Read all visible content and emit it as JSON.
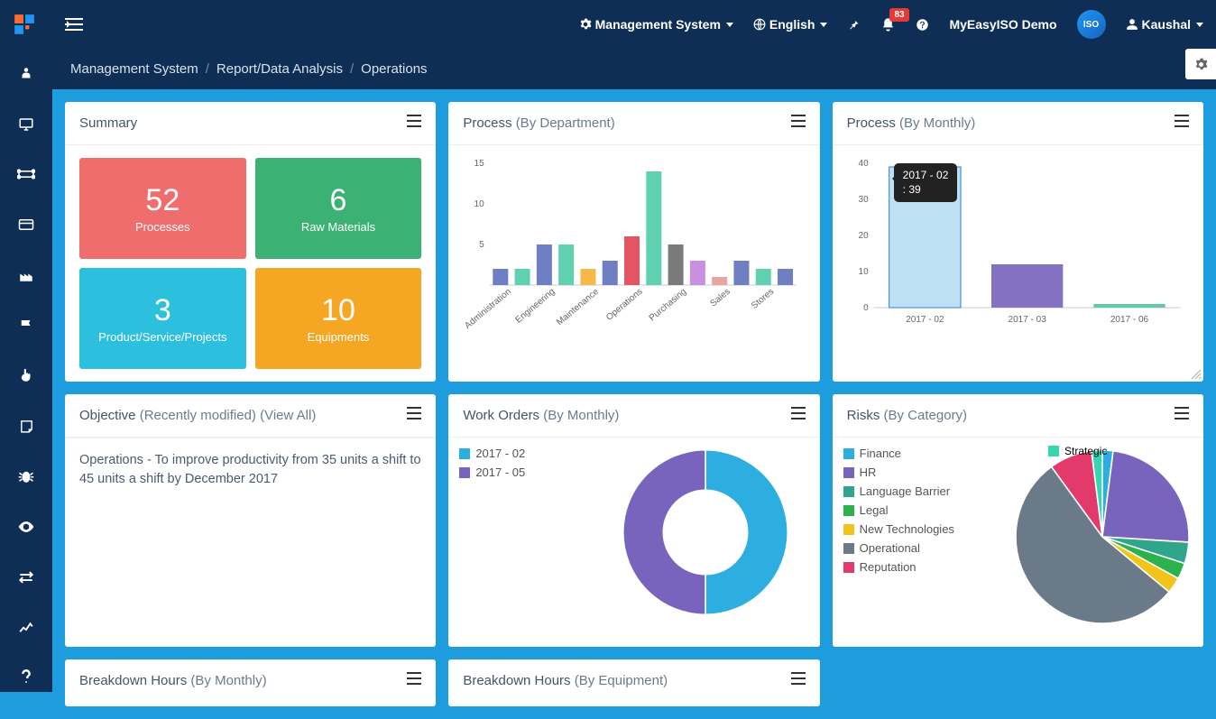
{
  "topnav": {
    "management_system": "Management System",
    "language": "English",
    "notifications_count": "83",
    "brand": "MyEasyISO Demo",
    "user": "Kaushal",
    "avatar_text": "ISO"
  },
  "breadcrumb": {
    "l1": "Management System",
    "l2": "Report/Data Analysis",
    "l3": "Operations"
  },
  "panels": {
    "summary": {
      "title": "Summary"
    },
    "process_dept": {
      "title": "Process",
      "subtitle": "(By Department)"
    },
    "process_month": {
      "title": "Process",
      "subtitle": "(By Monthly)"
    },
    "objective": {
      "title": "Objective",
      "sub1": "(Recently modified)",
      "sub2": "(View All)",
      "text": "Operations - To improve productivity from 35 units a shift to 45 units a shift by December 2017"
    },
    "work_orders": {
      "title": "Work Orders",
      "subtitle": "(By Monthly)"
    },
    "risks": {
      "title": "Risks",
      "subtitle": "(By Category)"
    },
    "bd_monthly": {
      "title": "Breakdown Hours",
      "subtitle": "(By Monthly)"
    },
    "bd_equipment": {
      "title": "Breakdown Hours",
      "subtitle": "(By Equipment)"
    }
  },
  "summary_tiles": [
    {
      "value": "52",
      "label": "Processes",
      "color": "#ef6d6d"
    },
    {
      "value": "6",
      "label": "Raw Materials",
      "color": "#3bb273"
    },
    {
      "value": "3",
      "label": "Product/Service/Projects",
      "color": "#2cc0de"
    },
    {
      "value": "10",
      "label": "Equipments",
      "color": "#f5a623"
    }
  ],
  "tooltip": {
    "line1": "2017 - 02",
    "line2": ": 39"
  },
  "chart_data": [
    {
      "id": "process_by_department",
      "type": "bar",
      "categories": [
        "Administration",
        "Administration",
        "Engineering",
        "Engineering",
        "Maintenance",
        "Maintenance",
        "Operations",
        "Operations",
        "Purchasing",
        "Purchasing",
        "Sales",
        "Sales",
        "Stores",
        "Stores"
      ],
      "category_labels": [
        "Administration",
        "Engineering",
        "Maintenance",
        "Operations",
        "Purchasing",
        "Sales",
        "Stores"
      ],
      "values": [
        2,
        2,
        5,
        5,
        2,
        3,
        6,
        14,
        5,
        3,
        1,
        3,
        2,
        2
      ],
      "colors": [
        "#6f7fc4",
        "#5fd0b0",
        "#6f7fc4",
        "#5fd0b0",
        "#f7b84b",
        "#6f7fc4",
        "#e25563",
        "#5fd0b0",
        "#7a7a7a",
        "#c98fe0",
        "#e8a6a0",
        "#6f7fc4",
        "#5fd0b0",
        "#6f7fc4"
      ],
      "ylim": [
        0,
        15
      ],
      "yticks": [
        5,
        10,
        15
      ]
    },
    {
      "id": "process_by_monthly",
      "type": "bar",
      "categories": [
        "2017 - 02",
        "2017 - 03",
        "2017 - 06"
      ],
      "values": [
        39,
        12,
        1
      ],
      "colors": [
        "#bde0f3",
        "#8471c1",
        "#62c9a8"
      ],
      "highlighted_index": 0,
      "ylim": [
        0,
        40
      ],
      "yticks": [
        0,
        10,
        20,
        30,
        40
      ]
    },
    {
      "id": "work_orders_monthly",
      "type": "pie",
      "donut": true,
      "series": [
        {
          "name": "2017 - 02",
          "value": 50,
          "color": "#2daee0"
        },
        {
          "name": "2017 - 05",
          "value": 50,
          "color": "#7864bd"
        }
      ]
    },
    {
      "id": "risks_by_category",
      "type": "pie",
      "series": [
        {
          "name": "Finance",
          "value": 2,
          "color": "#2daee0"
        },
        {
          "name": "HR",
          "value": 24,
          "color": "#7864bd"
        },
        {
          "name": "Language Barrier",
          "value": 4,
          "color": "#2fa58b"
        },
        {
          "name": "Legal",
          "value": 3,
          "color": "#2bb24c"
        },
        {
          "name": "New Technologies",
          "value": 3,
          "color": "#f0c419"
        },
        {
          "name": "Operational",
          "value": 54,
          "color": "#6b7a88"
        },
        {
          "name": "Reputation",
          "value": 8,
          "color": "#e23a6a"
        },
        {
          "name": "Strategic",
          "value": 2,
          "color": "#36d6b0"
        }
      ]
    }
  ]
}
